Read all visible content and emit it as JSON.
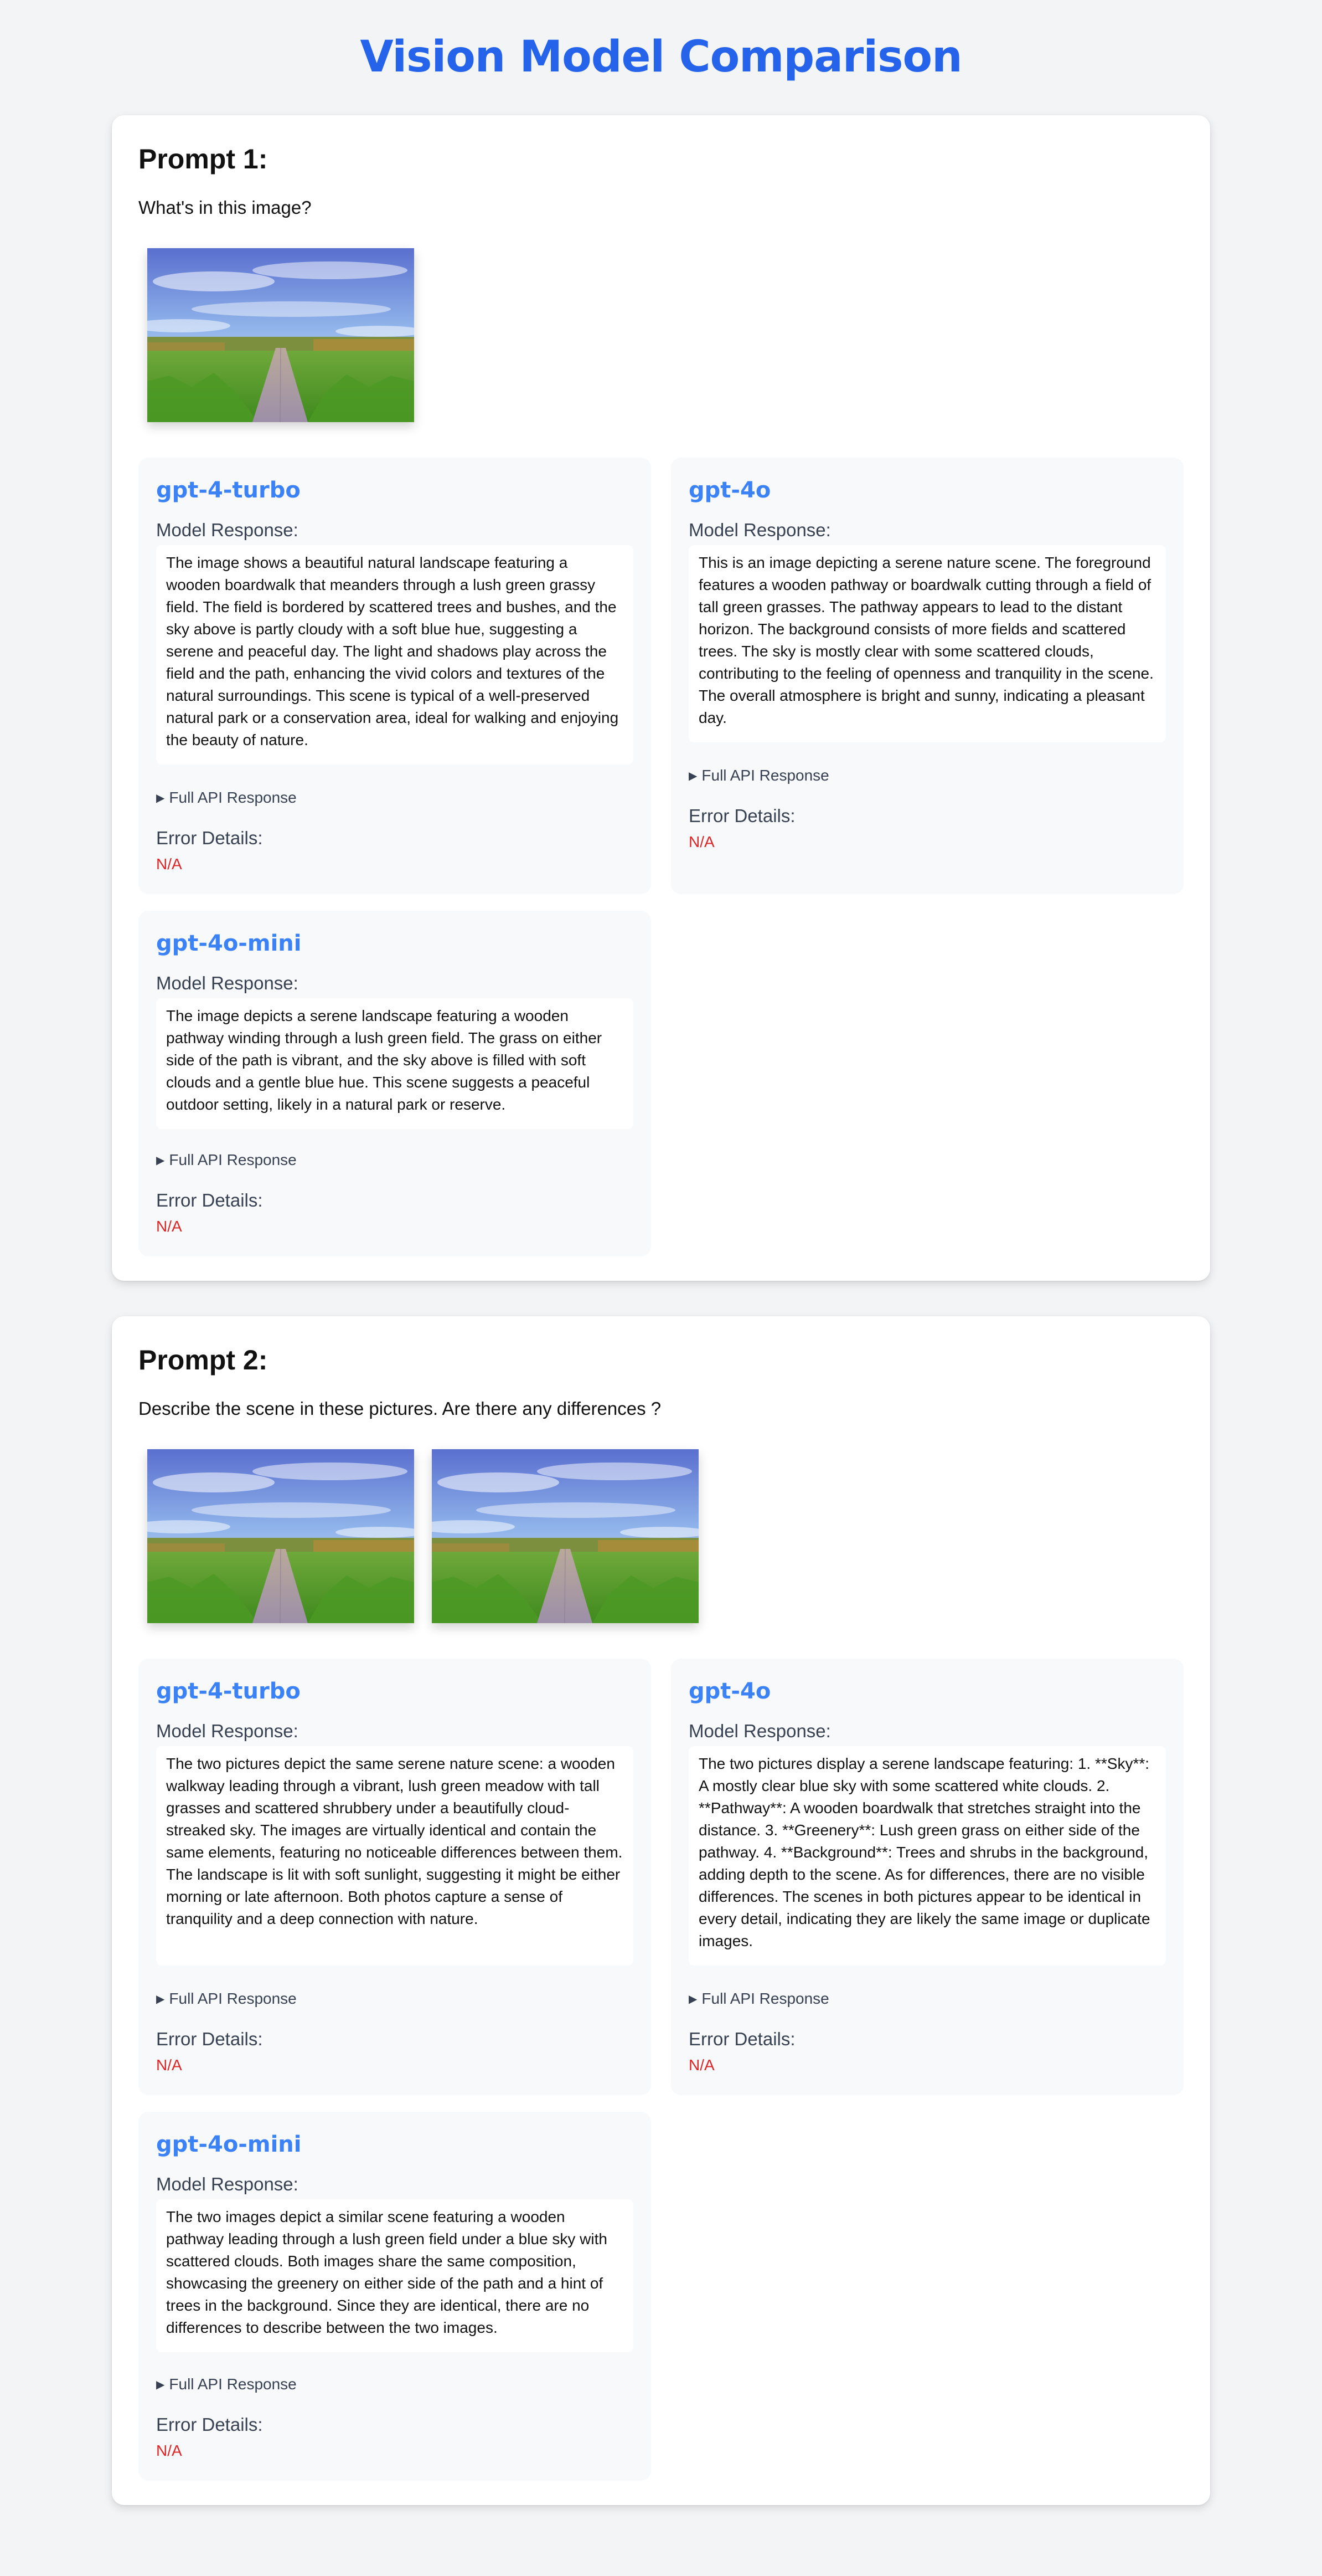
{
  "page": {
    "title": "Vision Model Comparison"
  },
  "labels": {
    "model_response": "Model Response:",
    "full_api_response": "Full API Response",
    "error_details": "Error Details:"
  },
  "prompts": [
    {
      "heading": "Prompt 1:",
      "text": "What's in this image?",
      "results": [
        {
          "model": "gpt-4-turbo",
          "response": "The image shows a beautiful natural landscape featuring a wooden boardwalk that meanders through a lush green grassy field. The field is bordered by scattered trees and bushes, and the sky above is partly cloudy with a soft blue hue, suggesting a serene and peaceful day. The light and shadows play across the field and the path, enhancing the vivid colors and textures of the natural surroundings. This scene is typical of a well-preserved natural park or a conservation area, ideal for walking and enjoying the beauty of nature.",
          "error": "N/A"
        },
        {
          "model": "gpt-4o",
          "response": "This is an image depicting a serene nature scene. The foreground features a wooden pathway or boardwalk cutting through a field of tall green grasses. The pathway appears to lead to the distant horizon. The background consists of more fields and scattered trees. The sky is mostly clear with some scattered clouds, contributing to the feeling of openness and tranquility in the scene. The overall atmosphere is bright and sunny, indicating a pleasant day.",
          "error": "N/A"
        },
        {
          "model": "gpt-4o-mini",
          "response": "The image depicts a serene landscape featuring a wooden pathway winding through a lush green field. The grass on either side of the path is vibrant, and the sky above is filled with soft clouds and a gentle blue hue. This scene suggests a peaceful outdoor setting, likely in a natural park or reserve.",
          "error": "N/A"
        }
      ]
    },
    {
      "heading": "Prompt 2:",
      "text": "Describe the scene in these pictures. Are there any differences ?",
      "results": [
        {
          "model": "gpt-4-turbo",
          "response": "The two pictures depict the same serene nature scene: a wooden walkway leading through a vibrant, lush green meadow with tall grasses and scattered shrubbery under a beautifully cloud-streaked sky. The images are virtually identical and contain the same elements, featuring no noticeable differences between them. The landscape is lit with soft sunlight, suggesting it might be either morning or late afternoon. Both photos capture a sense of tranquility and a deep connection with nature.",
          "error": "N/A"
        },
        {
          "model": "gpt-4o",
          "response": "The two pictures display a serene landscape featuring: 1. **Sky**: A mostly clear blue sky with some scattered white clouds. 2. **Pathway**: A wooden boardwalk that stretches straight into the distance. 3. **Greenery**: Lush green grass on either side of the pathway. 4. **Background**: Trees and shrubs in the background, adding depth to the scene. As for differences, there are no visible differences. The scenes in both pictures appear to be identical in every detail, indicating they are likely the same image or duplicate images.",
          "error": "N/A"
        },
        {
          "model": "gpt-4o-mini",
          "response": "The two images depict a similar scene featuring a wooden pathway leading through a lush green field under a blue sky with scattered clouds. Both images share the same composition, showcasing the greenery on either side of the path and a hint of trees in the background. Since they are identical, there are no differences to describe between the two images.",
          "error": "N/A"
        }
      ]
    }
  ]
}
